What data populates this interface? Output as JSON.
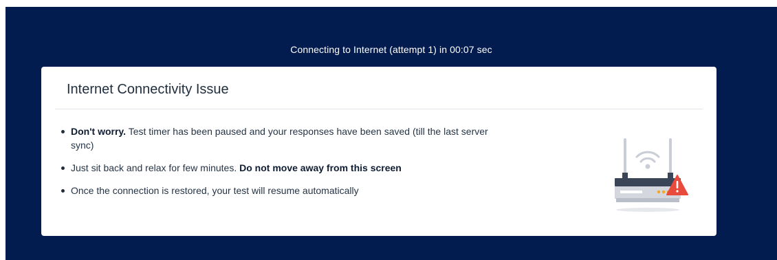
{
  "status": {
    "text": "Connecting to Internet (attempt 1) in 00:07 sec"
  },
  "card": {
    "title": "Internet Connectivity Issue",
    "bullets": [
      {
        "bold": "Don't worry.",
        "text": " Test timer has been paused and your responses have been saved (till the last server sync)"
      },
      {
        "text": "Just sit back and relax for few minutes. ",
        "bold": "Do not move away from this screen"
      },
      {
        "text": "Once the connection is restored, your test will resume automatically"
      }
    ],
    "illustration_icon": "router-warning-icon"
  },
  "colors": {
    "backdrop": "#031c4f",
    "card": "#ffffff",
    "warning": "#e84a3c",
    "router_body": "#d4d7de"
  }
}
